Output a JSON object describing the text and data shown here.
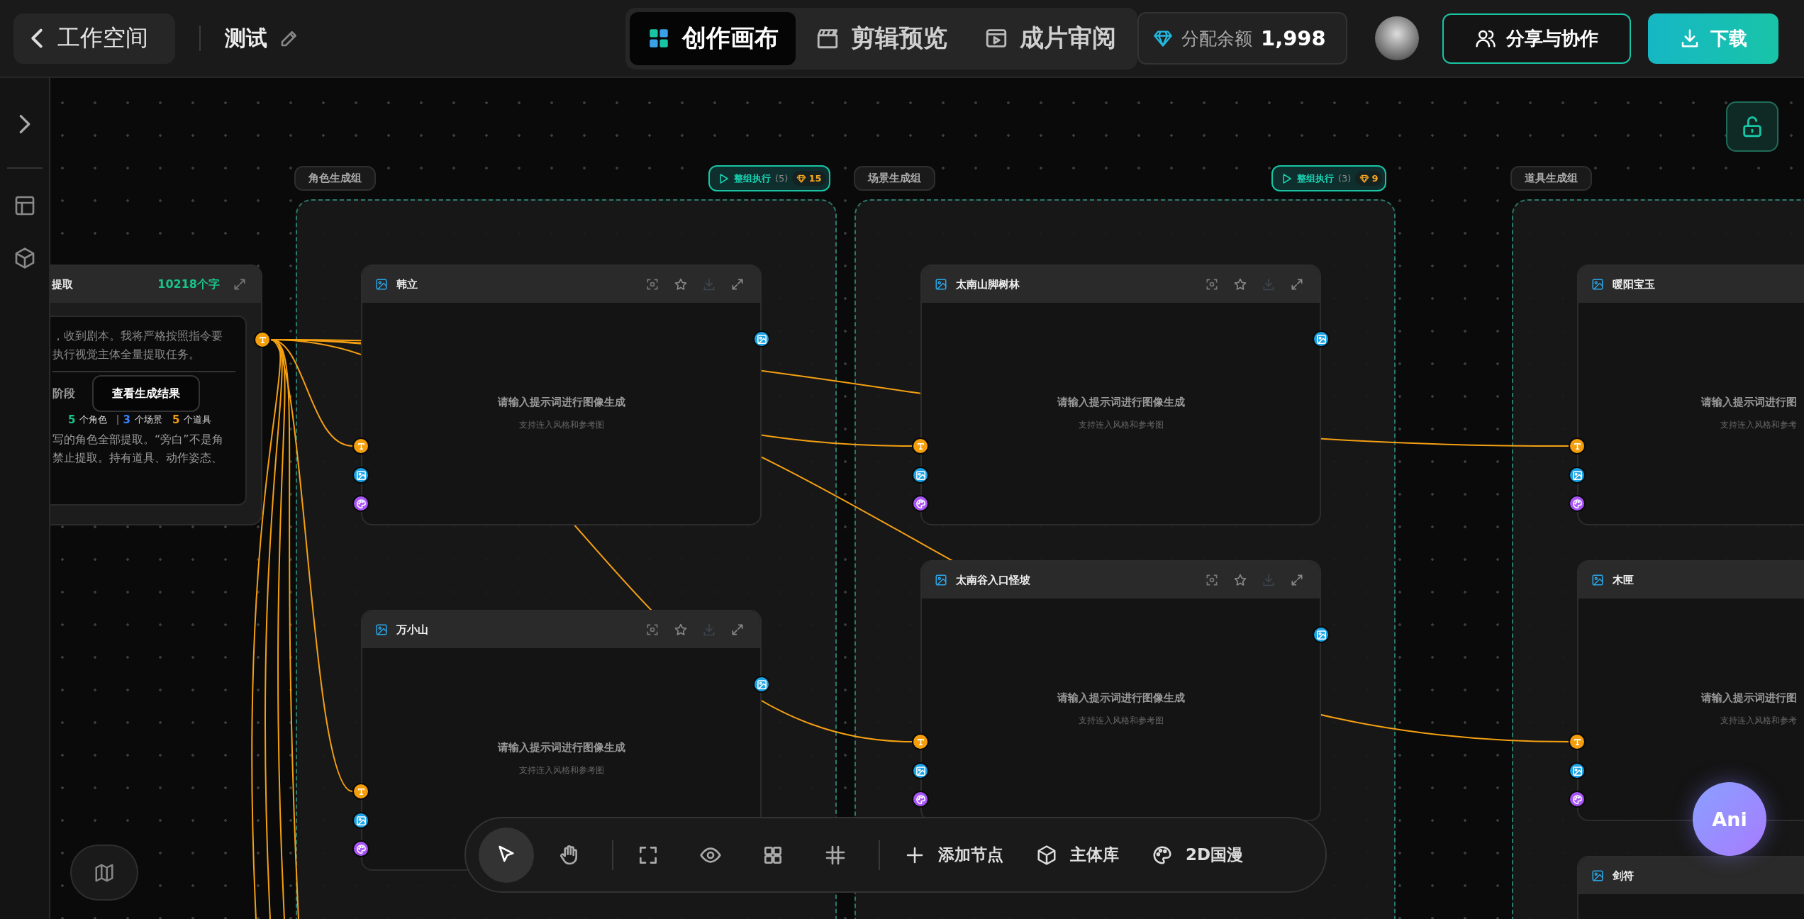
{
  "header": {
    "back_label": "工作空间",
    "project_name": "测试",
    "tabs": [
      {
        "kind": "canvas",
        "label": "创作画布",
        "selected": true
      },
      {
        "kind": "edit",
        "label": "剪辑预览",
        "selected": false
      },
      {
        "kind": "review",
        "label": "成片审阅",
        "selected": false
      }
    ],
    "balance": {
      "label": "分配余额",
      "value": "1,998"
    },
    "buttons": [
      {
        "kind": "outline",
        "label": "分享与协作"
      },
      {
        "kind": "primary",
        "label": "下载"
      }
    ]
  },
  "script_node": {
    "title": "提取",
    "char_count": "10218个字",
    "lines": [
      "，收到剧本。我将严格按照指令要",
      "执行视觉主体全量提取任务。"
    ],
    "heading": "阶段",
    "view_button": "查看生成结果",
    "stats": [
      {
        "count": "5",
        "label": "个角色",
        "color": "#19c48a"
      },
      {
        "count": "3",
        "label": "个场景",
        "color": "#3b82f6"
      },
      {
        "count": "5",
        "label": "个道具",
        "color": "#f59e0b"
      }
    ],
    "lines_after": [
      "写的角色全部提取。“旁白”不是角",
      "禁止提取。持有道具、动作姿态、"
    ]
  },
  "groups": [
    {
      "label": "角色生成组",
      "run_button": {
        "label": "整组执行",
        "count": "(5)",
        "cost": "15"
      },
      "nodes": [
        {
          "title": "韩立",
          "hint": "请输入提示词进行图像生成",
          "sub_hint": "支持连入风格和参考图"
        },
        {
          "title": "万小山",
          "hint": "请输入提示词进行图像生成",
          "sub_hint": "支持连入风格和参考图"
        }
      ]
    },
    {
      "label": "场景生成组",
      "run_button": {
        "label": "整组执行",
        "count": "(3)",
        "cost": "9"
      },
      "nodes": [
        {
          "title": "太南山脚树林",
          "hint": "请输入提示词进行图像生成",
          "sub_hint": "支持连入风格和参考图"
        },
        {
          "title": "太南谷入口怪坡",
          "hint": "请输入提示词进行图像生成",
          "sub_hint": "支持连入风格和参考图"
        }
      ]
    },
    {
      "label": "道具生成组",
      "nodes": [
        {
          "title": "暖阳宝玉",
          "hint": "请输入提示词进行图",
          "sub_hint": "支持连入风格和参考"
        },
        {
          "title": "木匣",
          "hint": "请输入提示词进行图",
          "sub_hint": "支持连入风格和参考"
        },
        {
          "title": "剑符"
        }
      ]
    }
  ],
  "toolbar": {
    "tool_groups": [
      [
        {
          "kind": "select",
          "selected": true
        },
        {
          "kind": "hand",
          "selected": false
        }
      ],
      [
        {
          "kind": "frame",
          "selected": false
        },
        {
          "kind": "preview",
          "selected": false
        },
        {
          "kind": "layout",
          "selected": false
        },
        {
          "kind": "grid",
          "selected": false
        }
      ]
    ],
    "actions": [
      {
        "kind": "add",
        "label": "添加节点"
      },
      {
        "kind": "library",
        "label": "主体库"
      },
      {
        "kind": "style",
        "label": "2D国漫"
      }
    ]
  },
  "assistant": {
    "label": "Ani"
  }
}
